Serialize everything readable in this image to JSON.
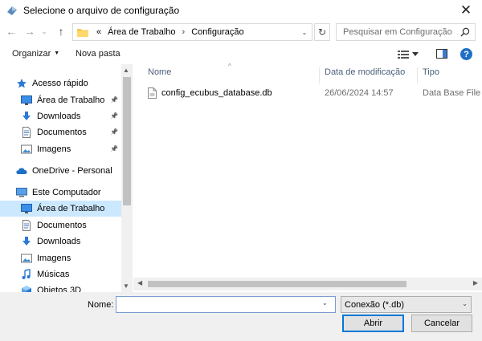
{
  "window": {
    "title": "Selecione o arquivo de configuração",
    "close_glyph": "✕"
  },
  "nav": {
    "back_glyph": "←",
    "forward_glyph": "→",
    "recent_glyph": "⌄",
    "up_glyph": "↑"
  },
  "address": {
    "overflow": "«",
    "crumbs": [
      "Área de Trabalho",
      "Configuração"
    ],
    "separator": "›",
    "dropdown_glyph": "⌄",
    "refresh_glyph": "↻"
  },
  "search": {
    "placeholder": "Pesquisar em Configuração"
  },
  "toolbar": {
    "organize_label": "Organizar",
    "organize_caret": "▼",
    "new_folder_label": "Nova pasta",
    "help_label": "?"
  },
  "sidebar": {
    "items": [
      {
        "label": "Acesso rápido",
        "icon": "star-icon",
        "indent": 0,
        "pinned": false,
        "selected": false
      },
      {
        "label": "Área de Trabalho",
        "icon": "desktop-icon",
        "indent": 1,
        "pinned": true,
        "selected": false
      },
      {
        "label": "Downloads",
        "icon": "download-icon",
        "indent": 1,
        "pinned": true,
        "selected": false
      },
      {
        "label": "Documentos",
        "icon": "document-icon",
        "indent": 1,
        "pinned": true,
        "selected": false
      },
      {
        "label": "Imagens",
        "icon": "image-icon",
        "indent": 1,
        "pinned": true,
        "selected": false
      },
      {
        "label": "OneDrive - Personal",
        "icon": "cloud-icon",
        "indent": 0,
        "pinned": false,
        "selected": false
      },
      {
        "label": "Este Computador",
        "icon": "computer-icon",
        "indent": 0,
        "pinned": false,
        "selected": false
      },
      {
        "label": "Área de Trabalho",
        "icon": "desktop-icon",
        "indent": 1,
        "pinned": false,
        "selected": true
      },
      {
        "label": "Documentos",
        "icon": "document-icon",
        "indent": 1,
        "pinned": false,
        "selected": false
      },
      {
        "label": "Downloads",
        "icon": "download-icon",
        "indent": 1,
        "pinned": false,
        "selected": false
      },
      {
        "label": "Imagens",
        "icon": "image-icon",
        "indent": 1,
        "pinned": false,
        "selected": false
      },
      {
        "label": "Músicas",
        "icon": "music-icon",
        "indent": 1,
        "pinned": false,
        "selected": false
      },
      {
        "label": "Objetos 3D",
        "icon": "cube-icon",
        "indent": 1,
        "pinned": false,
        "selected": false
      }
    ]
  },
  "columns": {
    "name": "Nome",
    "modified": "Data de modificação",
    "type": "Tipo"
  },
  "files": [
    {
      "name": "config_ecubus_database.db",
      "modified": "26/06/2024 14:57",
      "type": "Data Base File",
      "icon": "db-file-icon"
    }
  ],
  "bottom": {
    "name_label": "Nome:",
    "name_value": "",
    "file_type": "Conexão (*.db)",
    "open_label": "Abrir",
    "cancel_label": "Cancelar"
  },
  "colors": {
    "accent": "#0078d7",
    "selection": "#cce8ff",
    "folder": "#f2c94c",
    "help": "#1f6fc6"
  }
}
